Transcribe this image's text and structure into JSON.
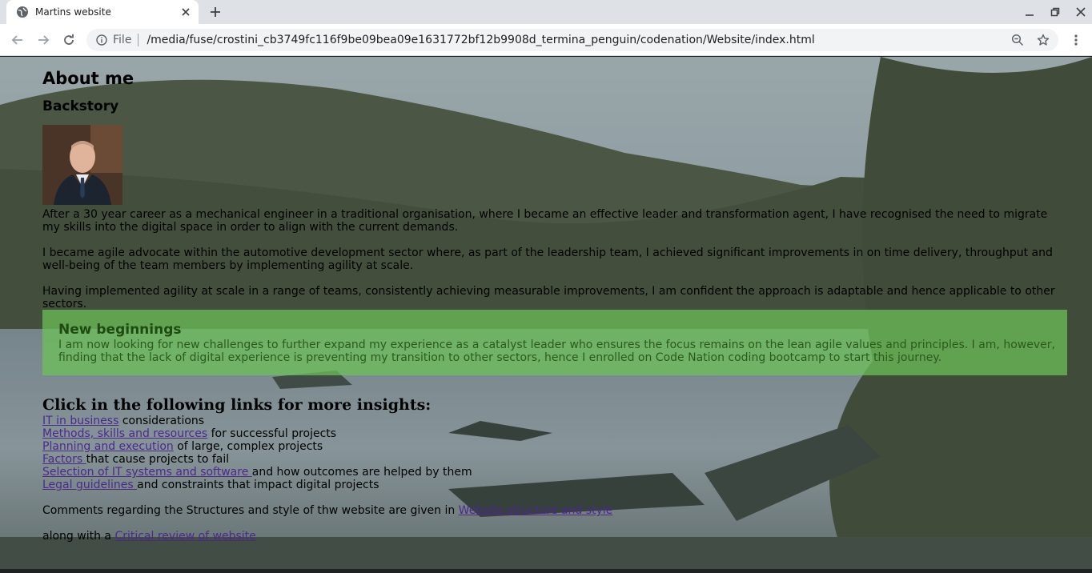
{
  "browser": {
    "tab_title": "Martins website",
    "url_scheme": "File",
    "url": "/media/fuse/crostini_cb3749fc116f9be09bea09e1631772bf12b9908d_termina_penguin/codenation/Website/index.html"
  },
  "page": {
    "heading": "About me",
    "subheading": "Backstory",
    "paragraphs": [
      "After a 30 year career as a mechanical engineer in a traditional organisation, where I became an effective leader and transformation agent, I have recognised the need to migrate my skills into the digital space in order to align with the current demands.",
      "I became agile advocate within the automotive development sector where, as part of the leadership team, I achieved significant improvements in on time delivery, throughput and well-being of the team members by implementing agility at scale.",
      "Having implemented agility at scale in a range of teams, consistently achieving measurable improvements, I am confident the approach is adaptable and hence applicable to other sectors."
    ],
    "new_beginnings": {
      "title": "New beginnings",
      "text": "I am now looking for new challenges to further expand my experience as a catalyst leader who ensures the focus remains on the lean agile values and principles. I am, however, finding that the lack of digital experience is preventing my transition to other sectors, hence I enrolled on Code Nation coding bootcamp to start this journey."
    },
    "links_heading": "Click in the following links for more insights:",
    "links": [
      {
        "link": "IT in business",
        "rest": " considerations"
      },
      {
        "link": "Methods, skills and resources",
        "rest": " for successful projects"
      },
      {
        "link": "Planning and execution",
        "rest": " of large, complex projects"
      },
      {
        "link": "Factors ",
        "rest": "that cause projects to fail"
      },
      {
        "link": "Selection of IT systems and software ",
        "rest": "and how outcomes are helped by them"
      },
      {
        "link": "Legal guidelines ",
        "rest": "and constraints that impact digital projects"
      }
    ],
    "comments_text": "Comments regarding the Structures and style of thw website are given in ",
    "comments_link": "Website structure and style",
    "review_text": "along with a ",
    "review_link": "Critical review of website"
  },
  "colors": {
    "new_box_bg": "#6cc458",
    "link": "#4a2a8a"
  }
}
